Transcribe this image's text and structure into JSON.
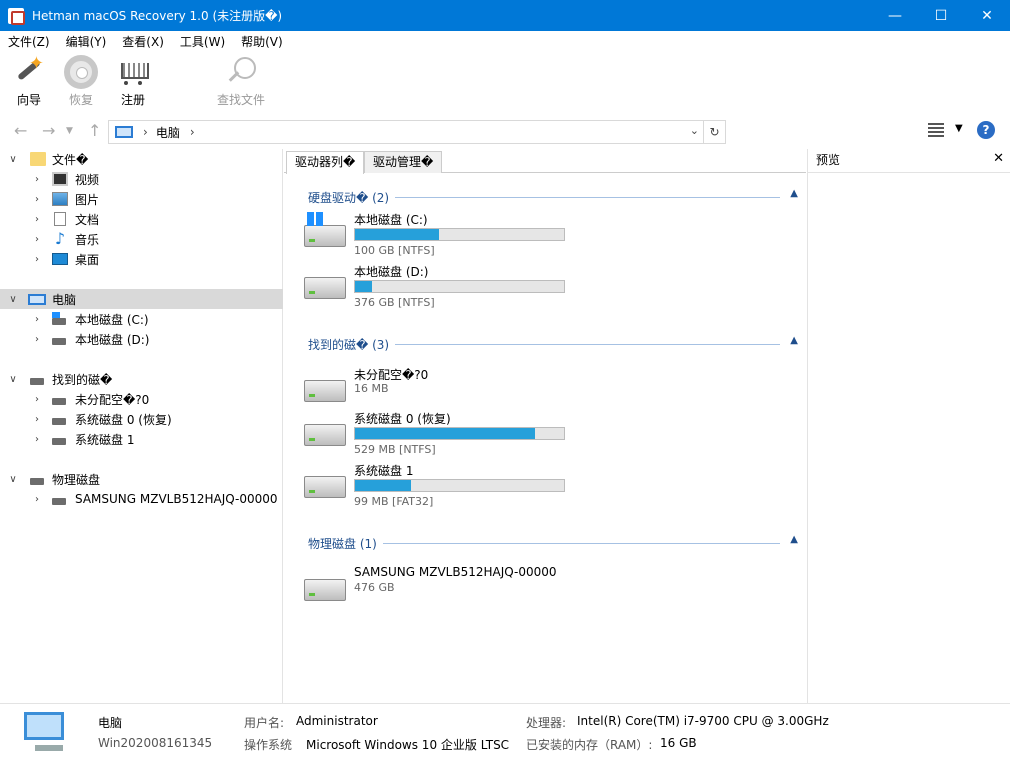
{
  "window": {
    "title": "Hetman macOS Recovery 1.0 (未注册版�)"
  },
  "menu": [
    "文件(Z)",
    "编辑(Y)",
    "查看(X)",
    "工具(W)",
    "帮助(V)"
  ],
  "toolbar": {
    "wizard": "向导",
    "restore": "恢复",
    "register": "注册",
    "find": "查找文件"
  },
  "address": {
    "crumb": "电脑"
  },
  "tree": {
    "files": "文件�",
    "video": "视频",
    "pictures": "图片",
    "documents": "文档",
    "music": "音乐",
    "desktop": "桌面",
    "computer": "电脑",
    "disk_c": "本地磁盘 (C:)",
    "disk_d": "本地磁盘 (D:)",
    "found": "找到的磁�",
    "unalloc": "未分配空�?0",
    "sys0": "系统磁盘 0 (恢复)",
    "sys1": "系统磁盘 1",
    "physical": "物理磁盘",
    "samsung": "SAMSUNG MZVLB512HAJQ-00000"
  },
  "tabs": [
    "驱动器列�",
    "驱动管理�"
  ],
  "groups": {
    "hdd": "硬盘驱动� (2)",
    "found": "找到的磁� (3)",
    "physical": "物理磁盘 (1)"
  },
  "disks": {
    "c": {
      "name": "本地磁盘 (C:)",
      "size": "100 GB [NTFS]",
      "used": 0.4
    },
    "d": {
      "name": "本地磁盘 (D:)",
      "size": "376 GB [NTFS]",
      "used": 0.08
    },
    "unalloc": {
      "name": "未分配空�?0",
      "size": "16 MB"
    },
    "sys0": {
      "name": "系统磁盘 0 (恢复)",
      "size": "529 MB [NTFS]",
      "used": 0.86
    },
    "sys1": {
      "name": "系统磁盘 1",
      "size": "99 MB [FAT32]",
      "used": 0.27
    },
    "samsung": {
      "name": "SAMSUNG MZVLB512HAJQ-00000",
      "size": "476 GB"
    }
  },
  "preview": {
    "title": "预览"
  },
  "status": {
    "pc_name": "电脑",
    "pc_id": "Win202008161345",
    "user_label": "用户名:",
    "user": "Administrator",
    "os_label": "操作系统",
    "os": "Microsoft Windows 10 企业版 LTSC",
    "cpu_label": "处理器:",
    "cpu": "Intel(R) Core(TM) i7-9700 CPU @ 3.00GHz",
    "ram_label": "已安装的内存（RAM）:",
    "ram": "16 GB"
  },
  "colors": {
    "titlebar": "#0078d7",
    "bar_fill": "#26a0da",
    "group_text": "#1f4e8c"
  }
}
